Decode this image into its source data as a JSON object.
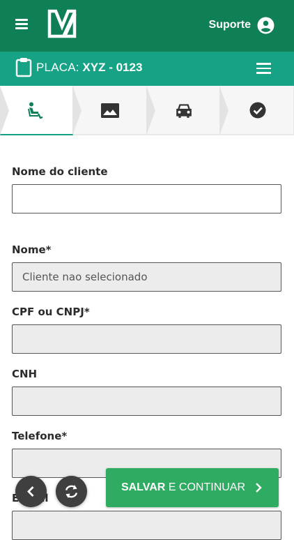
{
  "header": {
    "support_label": "Suporte",
    "icons": [
      "hamburger-menu-icon",
      "app-logo",
      "user-account-icon"
    ]
  },
  "plate": {
    "label": "PLACA:",
    "value": "XYZ - 0123",
    "icons": [
      "clipboard-icon",
      "menu-icon"
    ]
  },
  "steps": [
    {
      "icon": "seat-icon",
      "active": true
    },
    {
      "icon": "image-icon",
      "active": false
    },
    {
      "icon": "car-icon",
      "active": false
    },
    {
      "icon": "check-circle-icon",
      "active": false
    }
  ],
  "form": {
    "client_name_label": "Nome do cliente",
    "client_name_value": "",
    "name_label": "Nome*",
    "name_value": "Cliente nao selecionado",
    "cpf_label": "CPF ou CNPJ*",
    "cpf_value": "",
    "cnh_label": "CNH",
    "cnh_value": "",
    "phone_label": "Telefone*",
    "phone_value": "",
    "email_label": "E-mail",
    "email_value": ""
  },
  "actions": {
    "save_strong": "SALVAR",
    "save_rest": " E CONTINUAR",
    "back_icon": "chevron-left-icon",
    "refresh_icon": "refresh-icon"
  },
  "colors": {
    "header": "#0f7f55",
    "plate_bar": "#16a385",
    "save_button": "#2fab62"
  }
}
